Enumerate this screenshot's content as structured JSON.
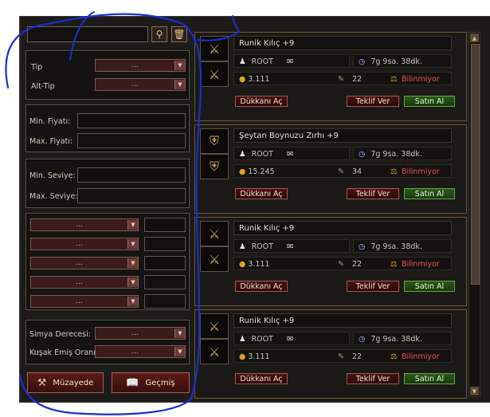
{
  "filters": {
    "type_label": "Tip",
    "subtype_label": "Alt-Tip",
    "type_value": "...",
    "subtype_value": "...",
    "min_price_label": "Min. Fiyatı:",
    "max_price_label": "Max. Fiyatı:",
    "min_level_label": "Min. Seviye:",
    "max_level_label": "Max. Seviye:",
    "bonus_dropdowns": [
      "...",
      "...",
      "...",
      "...",
      "..."
    ],
    "alchemy_label": "Simya Derecesi:",
    "alchemy_value": "...",
    "belt_label": "Kuşak Emiş Oranı:",
    "belt_value": "...",
    "museum_label": "Müzayede",
    "history_label": "Geçmiş"
  },
  "listings": [
    {
      "name": "Runik Kılıç +9",
      "seller": "ROOT",
      "time": "7g 9sa. 38dk.",
      "price": "3.111",
      "count": "22",
      "status": "Bilinmiyor",
      "icon": "sword-icon"
    },
    {
      "name": "Şeytan Boynuzu Zırhı +9",
      "seller": "ROOT",
      "time": "7g 9sa. 38dk.",
      "price": "15.245",
      "count": "34",
      "status": "Bilinmiyor",
      "icon": "armor-icon"
    },
    {
      "name": "Runik Kılıç +9",
      "seller": "ROOT",
      "time": "7g 9sa. 38dk.",
      "price": "3.111",
      "count": "22",
      "status": "Bilinmiyor",
      "icon": "sword-icon"
    },
    {
      "name": "Runik Kılıç +9",
      "seller": "ROOT",
      "time": "7g 9sa. 38dk.",
      "price": "3.111",
      "count": "22",
      "status": "Bilinmiyor",
      "icon": "sword-icon"
    }
  ],
  "buttons": {
    "open_shop": "Dükkanı Aç",
    "make_offer": "Teklif Ver",
    "buy": "Satın Al"
  },
  "colors": {
    "scribble": "#1a2ecf",
    "gold": "#e0a020",
    "status": "#e05050"
  }
}
